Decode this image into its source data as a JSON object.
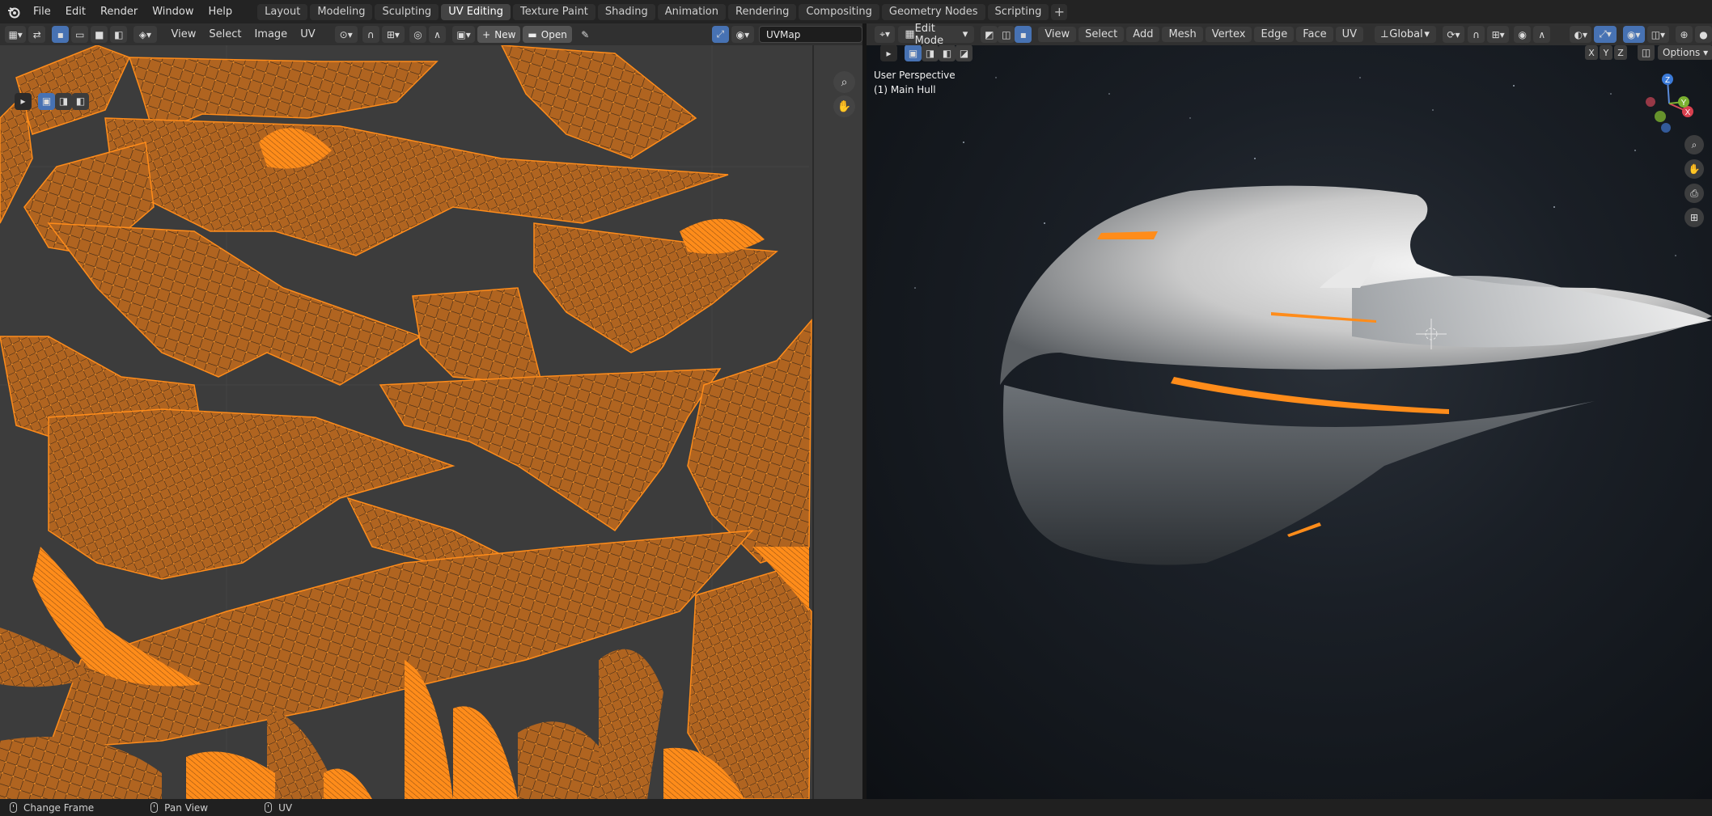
{
  "menubar": {
    "items": [
      "File",
      "Edit",
      "Render",
      "Window",
      "Help"
    ]
  },
  "workspaces": {
    "tabs": [
      "Layout",
      "Modeling",
      "Sculpting",
      "UV Editing",
      "Texture Paint",
      "Shading",
      "Animation",
      "Rendering",
      "Compositing",
      "Geometry Nodes",
      "Scripting"
    ],
    "active": "UV Editing"
  },
  "uv_editor": {
    "menus": [
      "View",
      "Select",
      "Image",
      "UV"
    ],
    "new_label": "New",
    "open_label": "Open",
    "uvmap_value": "UVMap"
  },
  "viewport": {
    "mode": "Edit Mode",
    "menus": [
      "View",
      "Select",
      "Add",
      "Mesh",
      "Vertex",
      "Edge",
      "Face",
      "UV"
    ],
    "transform_orientation": "Global",
    "perspective_label": "User Perspective",
    "object_label": "(1) Main Hull",
    "axis_buttons": [
      "X",
      "Y",
      "Z"
    ],
    "options_label": "Options",
    "gizmo_axes": {
      "x": "X",
      "y": "Y",
      "z": "Z"
    }
  },
  "statusbar": {
    "items": [
      "Change Frame",
      "Pan View",
      "UV"
    ]
  },
  "colors": {
    "accent_blue": "#4772b3",
    "uv_orange": "#ff8c1a",
    "uv_background": "#3c3c3c"
  }
}
